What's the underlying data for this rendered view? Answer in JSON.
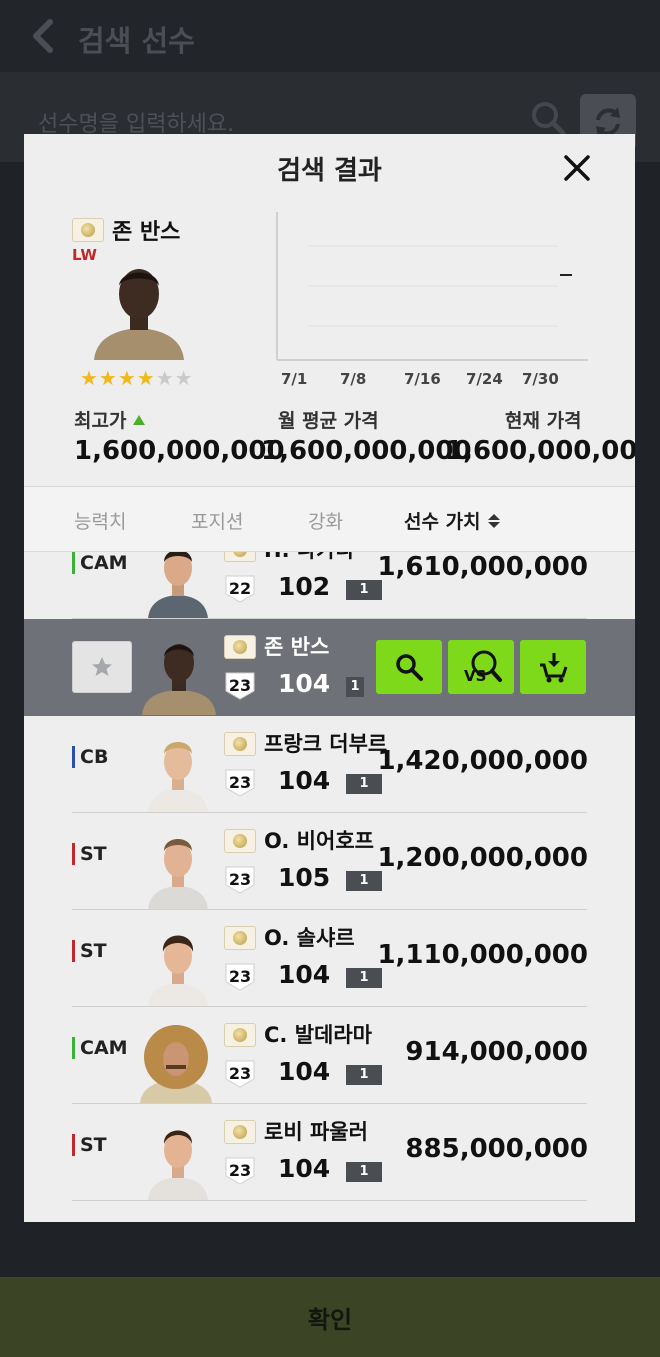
{
  "background": {
    "title": "검색 선수",
    "search_placeholder": "선수명을 입력하세요.",
    "confirm_label": "확인"
  },
  "modal": {
    "title": "검색 결과",
    "player": {
      "name": "존 반스",
      "position": "LW",
      "stars_filled": 4,
      "stars_total": 6
    },
    "graph": {
      "x_ticks": [
        "7/1",
        "7/8",
        "7/16",
        "7/24",
        "7/30"
      ]
    },
    "prices": [
      {
        "label": "최고가",
        "value": "1,600,000,000"
      },
      {
        "label": "월 평균 가격",
        "value": "1,600,000,000"
      },
      {
        "label": "현재 가격",
        "value": "1,600,000,000"
      }
    ],
    "tabs": [
      {
        "label": "능력치",
        "active": false
      },
      {
        "label": "포지션",
        "active": false
      },
      {
        "label": "강화",
        "active": false
      },
      {
        "label": "선수 가치",
        "active": true
      }
    ]
  },
  "players": [
    {
      "position": "CAM",
      "pos_color": "#3cae3a",
      "name": "H. 나카타",
      "season": "22",
      "ovr": "102",
      "level": "1",
      "value": "1,610,000,000"
    },
    {
      "position": "LW",
      "pos_color": "#c0282b",
      "name": "존 반스",
      "season": "23",
      "ovr": "104",
      "level": "1",
      "value": "",
      "selected": true
    },
    {
      "position": "CB",
      "pos_color": "#2a4fa8",
      "name": "프랑크 더부르",
      "season": "23",
      "ovr": "104",
      "level": "1",
      "value": "1,420,000,000"
    },
    {
      "position": "ST",
      "pos_color": "#c0282b",
      "name": "O. 비어호프",
      "season": "23",
      "ovr": "105",
      "level": "1",
      "value": "1,200,000,000"
    },
    {
      "position": "ST",
      "pos_color": "#c0282b",
      "name": "O. 솔샤르",
      "season": "23",
      "ovr": "104",
      "level": "1",
      "value": "1,110,000,000"
    },
    {
      "position": "CAM",
      "pos_color": "#3cae3a",
      "name": "C. 발데라마",
      "season": "23",
      "ovr": "104",
      "level": "1",
      "value": "914,000,000"
    },
    {
      "position": "ST",
      "pos_color": "#c0282b",
      "name": "로비 파울러",
      "season": "23",
      "ovr": "104",
      "level": "1",
      "value": "885,000,000"
    }
  ],
  "icons": {
    "back": "chevron-left-icon",
    "search": "search-icon",
    "refresh": "refresh-icon",
    "close": "close-icon",
    "compare": "vs-compare-icon",
    "buy": "cart-download-icon",
    "favorite": "star-icon"
  }
}
